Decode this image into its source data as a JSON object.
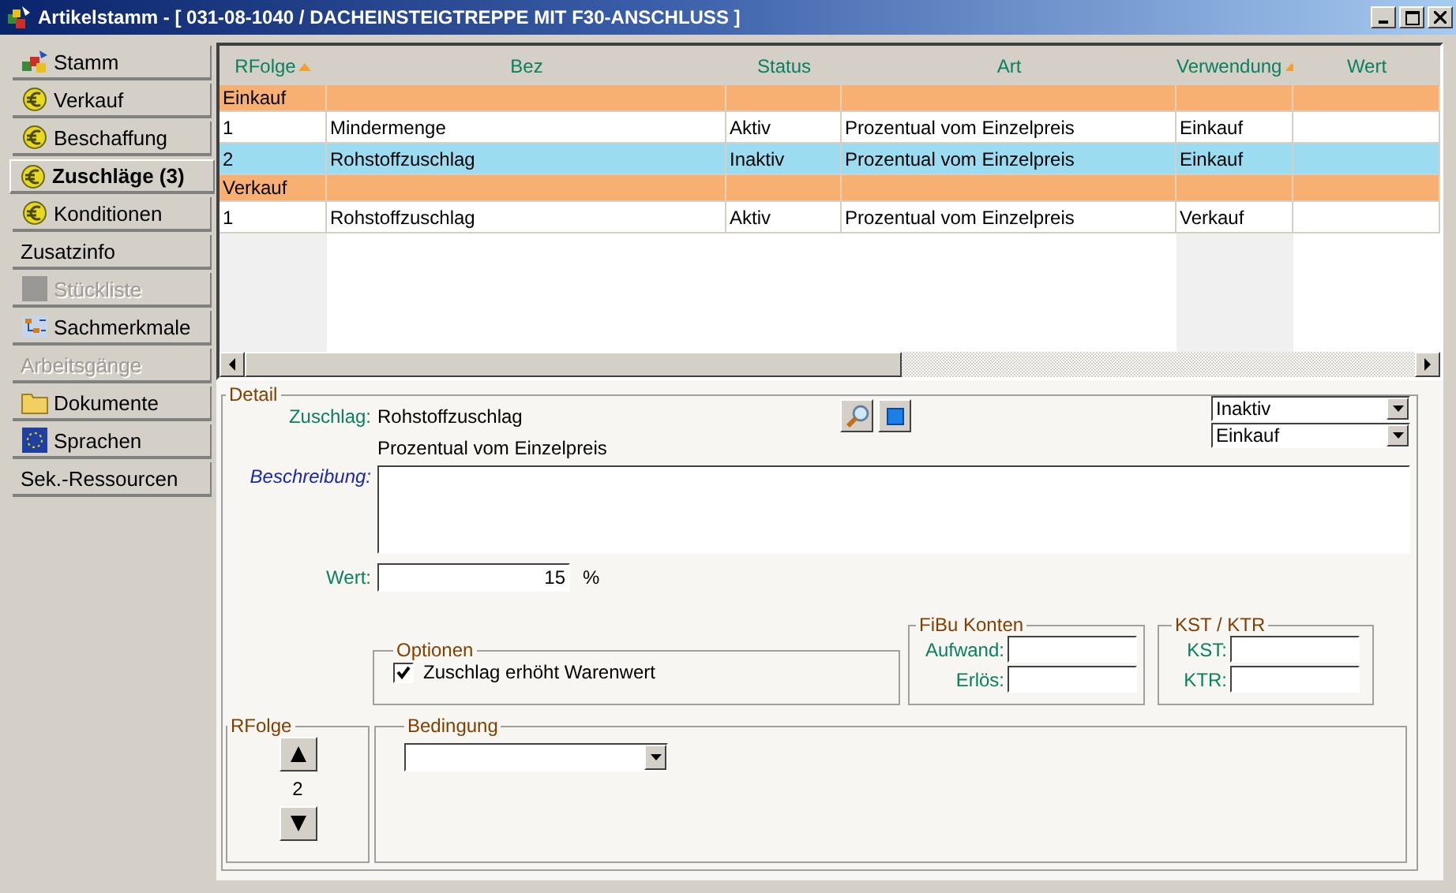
{
  "window": {
    "title": "Artikelstamm - [ 031-08-1040 / DACHEINSTEIGTREPPE MIT F30-ANSCHLUSS ]"
  },
  "sidebar": {
    "items": [
      {
        "label": "Stamm",
        "kind": "blocks",
        "selected": false,
        "disabled": false
      },
      {
        "label": "Verkauf",
        "kind": "coin",
        "selected": false,
        "disabled": false
      },
      {
        "label": "Beschaffung",
        "kind": "coin",
        "selected": false,
        "disabled": false
      },
      {
        "label": "Zuschläge (3)",
        "kind": "coin",
        "selected": true,
        "disabled": false
      },
      {
        "label": "Konditionen",
        "kind": "coin",
        "selected": false,
        "disabled": false
      },
      {
        "label": "Zusatzinfo",
        "kind": "plain",
        "selected": false,
        "disabled": false
      },
      {
        "label": "Stückliste",
        "kind": "square",
        "selected": false,
        "disabled": true
      },
      {
        "label": "Sachmerkmale",
        "kind": "tree",
        "selected": false,
        "disabled": false
      },
      {
        "label": "Arbeitsgänge",
        "kind": "plain",
        "selected": false,
        "disabled": true
      },
      {
        "label": "Dokumente",
        "kind": "folder",
        "selected": false,
        "disabled": false
      },
      {
        "label": "Sprachen",
        "kind": "flag",
        "selected": false,
        "disabled": false
      },
      {
        "label": "Sek.-Ressourcen",
        "kind": "plain",
        "selected": false,
        "disabled": false
      }
    ]
  },
  "table": {
    "columns": [
      {
        "label": "RFolge",
        "sorted": true
      },
      {
        "label": "Bez",
        "sorted": false
      },
      {
        "label": "Status",
        "sorted": false
      },
      {
        "label": "Art",
        "sorted": false
      },
      {
        "label": "Verwendung",
        "sorted": true
      },
      {
        "label": "Wert",
        "sorted": false
      }
    ],
    "rows": [
      {
        "kind": "group",
        "cells": [
          "Einkauf"
        ]
      },
      {
        "kind": "item",
        "selected": false,
        "cells": [
          "1",
          "Mindermenge",
          "Aktiv",
          "Prozentual vom Einzelpreis",
          "Einkauf",
          ""
        ]
      },
      {
        "kind": "item",
        "selected": true,
        "cells": [
          "2",
          "Rohstoffzuschlag",
          "Inaktiv",
          "Prozentual vom Einzelpreis",
          "Einkauf",
          ""
        ]
      },
      {
        "kind": "group",
        "cells": [
          "Verkauf"
        ]
      },
      {
        "kind": "item",
        "selected": false,
        "cells": [
          "1",
          "Rohstoffzuschlag",
          "Aktiv",
          "Prozentual vom Einzelpreis",
          "Verkauf",
          ""
        ]
      }
    ]
  },
  "detail": {
    "legend": "Detail",
    "zuschlag_label": "Zuschlag:",
    "zuschlag_value": "Rohstoffzuschlag",
    "art_value": "Prozentual vom Einzelpreis",
    "status_value": "Inaktiv",
    "verwendung_value": "Einkauf",
    "beschreibung_label": "Beschreibung:",
    "wert_label": "Wert:",
    "wert_value": "15",
    "wert_unit": "%",
    "optionen": {
      "legend": "Optionen",
      "checkbox_label": "Zuschlag erhöht Warenwert",
      "checked": true
    },
    "fibu": {
      "legend": "FiBu Konten",
      "aufwand_label": "Aufwand:",
      "erloes_label": "Erlös:"
    },
    "kst": {
      "legend": "KST / KTR",
      "kst_label": "KST:",
      "ktr_label": "KTR:"
    },
    "rfolge": {
      "legend": "RFolge",
      "value": "2"
    },
    "bedingung": {
      "legend": "Bedingung"
    }
  }
}
